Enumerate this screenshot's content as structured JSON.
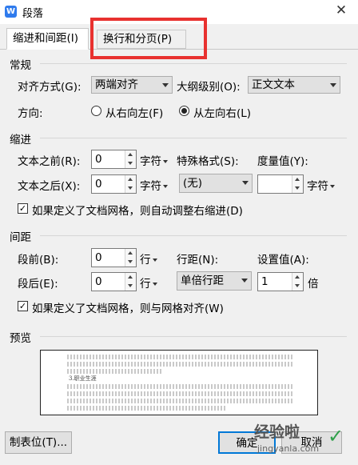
{
  "window": {
    "title": "段落",
    "app_icon_letter": "W"
  },
  "tabs": [
    {
      "label": "缩进和间距(I)",
      "active": true
    },
    {
      "label": "换行和分页(P)",
      "active": false
    }
  ],
  "general": {
    "heading": "常规",
    "alignment_label": "对齐方式(G):",
    "alignment_value": "两端对齐",
    "outline_label": "大纲级别(O):",
    "outline_value": "正文文本",
    "direction_label": "方向:",
    "rtl_label": "从右向左(F)",
    "ltr_label": "从左向右(L)",
    "direction_selected": "ltr"
  },
  "indent": {
    "heading": "缩进",
    "before_label": "文本之前(R):",
    "before_value": "0",
    "before_unit": "字符",
    "after_label": "文本之后(X):",
    "after_value": "0",
    "after_unit": "字符",
    "special_label": "特殊格式(S):",
    "special_value": "(无)",
    "measure_label": "度量值(Y):",
    "measure_value": "",
    "measure_unit": "字符",
    "grid_checkbox_label": "如果定义了文档网格，则自动调整右缩进(D)",
    "grid_checked": true
  },
  "spacing": {
    "heading": "间距",
    "before_label": "段前(B):",
    "before_value": "0",
    "before_unit": "行",
    "after_label": "段后(E):",
    "after_value": "0",
    "after_unit": "行",
    "line_label": "行距(N):",
    "line_value": "单倍行距",
    "setting_label": "设置值(A):",
    "setting_value": "1",
    "setting_unit": "倍",
    "grid_checkbox_label": "如果定义了文档网格，则与网格对齐(W)",
    "grid_checked": true
  },
  "preview": {
    "heading": "预览",
    "sample_heading": "3.职业生涯"
  },
  "footer": {
    "tabs_button": "制表位(T)...",
    "ok_button": "确定",
    "cancel_button": "取消"
  },
  "watermark": {
    "text": "经验啦",
    "url": "jingyanla.com"
  },
  "colors": {
    "highlight": "#e8312f",
    "app_icon": "#2f7bed"
  }
}
